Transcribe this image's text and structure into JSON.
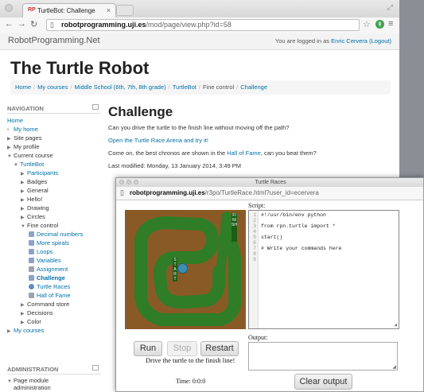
{
  "browser": {
    "tab_title": "TurtleBot: Challenge",
    "tab_favicon": "RP",
    "url_host": "robotprogramming.uji.es",
    "url_path": "/mod/page/view.php?id=58"
  },
  "site": {
    "brand": "RobotProgramming.Net",
    "login_prefix": "You are logged in as",
    "login_user": "Enric Cervera",
    "logout": "(Logout)"
  },
  "course_title": "The Turtle Robot",
  "breadcrumb": [
    "Home",
    "My courses",
    "Middle School (6th, 7th, 8th grade)",
    "TurtleBot",
    "Fine control",
    "Challenge"
  ],
  "navigation": {
    "heading": "NAVIGATION",
    "home": "Home",
    "my_home": "My home",
    "site_pages": "Site pages",
    "my_profile": "My profile",
    "current_course": "Current course",
    "turtlebot": "TurtleBot",
    "participants": "Participants",
    "badges": "Badges",
    "general": "General",
    "hello": "Hello!",
    "drawing": "Drawing",
    "circles": "Circles",
    "fine_control": "Fine control",
    "decimal_numbers": "Decimal numbers",
    "more_spirals": "More spirals",
    "loops": "Loops",
    "variables": "Variables",
    "assignment": "Assignment",
    "challenge": "Challenge",
    "turtle_races": "Turtle Races",
    "hall_of_fame": "Hall of Fame",
    "command_store": "Command store",
    "decisions": "Decisions",
    "color": "Color",
    "my_courses": "My courses"
  },
  "administration": {
    "heading": "ADMINISTRATION",
    "page_module_administration": "Page module administration"
  },
  "content": {
    "heading": "Challenge",
    "intro": "Can you drive the turtle to the finish line without moving off the path?",
    "open_link": "Open the Turtle Race Arena and try it!",
    "fame_prefix": "Come on, the best chronos are shown in the",
    "fame_link": "Hall of Fame",
    "fame_suffix": ", can you beat them?",
    "last_modified": "Last modified: Monday, 13 January 2014, 3:49 PM"
  },
  "popup": {
    "title": "Turtle Races",
    "url_host": "robotprogramming.uji.es",
    "url_path": "/r3po/TurtleRace.html?user_id=ecervera",
    "script_label": "Script:",
    "output_label": "Output:",
    "start_label": "START",
    "finish_label": "FINISH",
    "code_lines": [
      "#!/usr/bin/env python",
      "",
      "from rpn.turtle import *",
      "",
      "start()",
      "",
      "# Write your commands here",
      "",
      ""
    ],
    "run": "Run",
    "stop": "Stop",
    "restart": "Restart",
    "message": "Drive the turtle to the finish line!",
    "time": "Time: 0:0:0",
    "clear_output": "Clear output"
  }
}
